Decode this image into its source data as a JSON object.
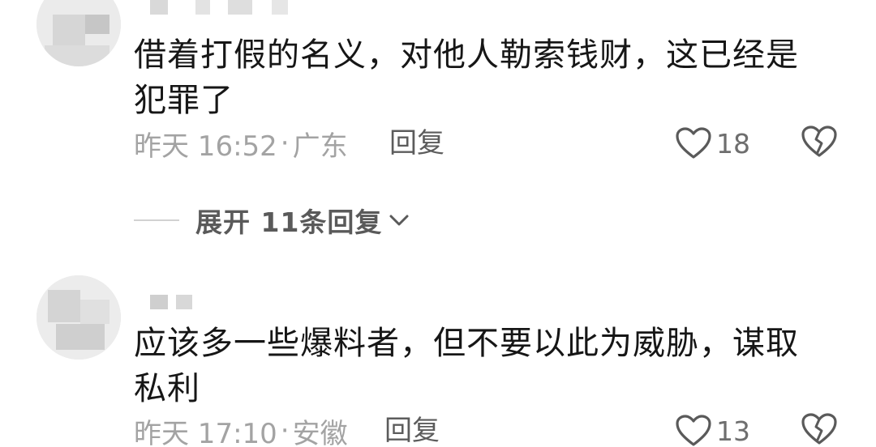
{
  "comments": [
    {
      "text": "借着打假的名义，对他人勒索钱财，这已经是\n犯罪了",
      "timestamp": "昨天 16:52",
      "separator": "·",
      "location": "广东",
      "reply_label": "回复",
      "like_count": "18",
      "replies": {
        "expand_label": "展开 11条回复"
      }
    },
    {
      "text": "应该多一些爆料者，但不要以此为威胁，谋取\n私利",
      "timestamp": "昨天 17:10",
      "separator": "·",
      "location": "安徽",
      "reply_label": "回复",
      "like_count": "13"
    }
  ],
  "icons": {
    "like": "heart-outline-icon",
    "dislike": "broken-heart-icon",
    "expand": "chevron-down-icon"
  },
  "colors": {
    "text": "#161616",
    "meta": "#a3a3a3",
    "reply": "#5c5c5c",
    "icon": "#5a5a5a"
  }
}
